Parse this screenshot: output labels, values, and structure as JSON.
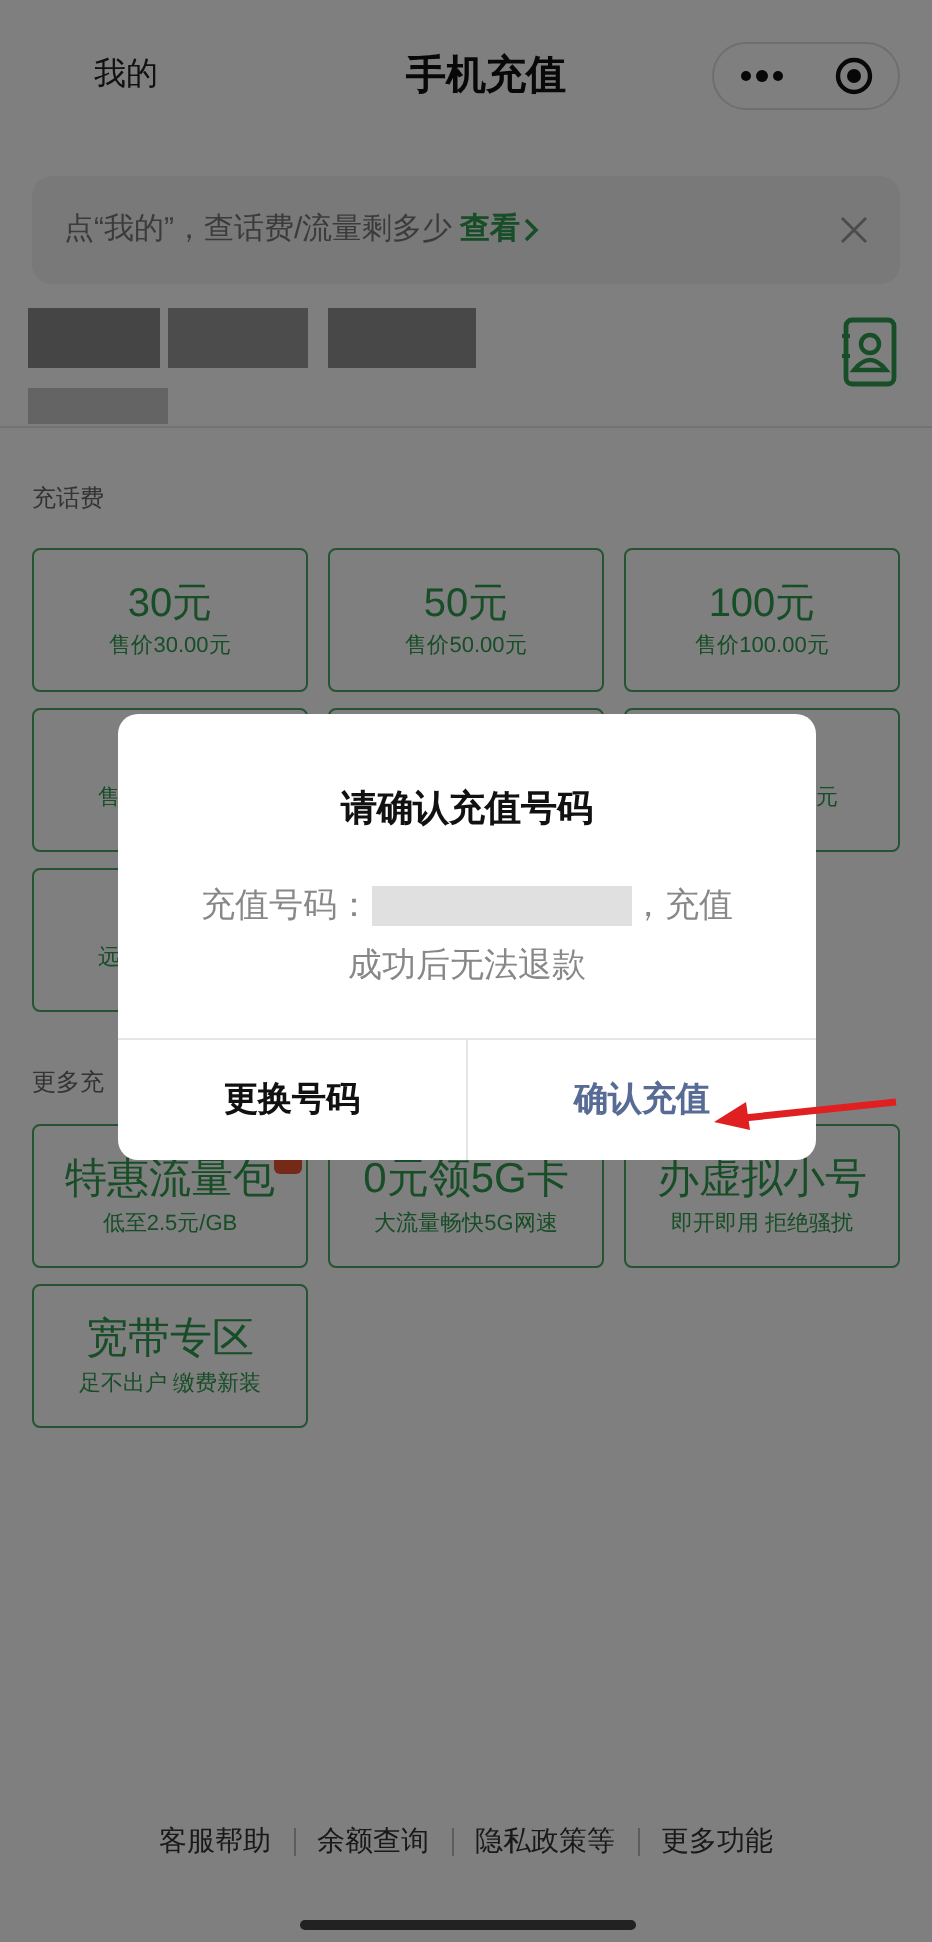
{
  "nav": {
    "back_label": "我的",
    "title": "手机充值"
  },
  "banner": {
    "text": "点“我的”，查话费/流量剩多少",
    "link": "查看"
  },
  "section_call": {
    "title": "充话费",
    "cards": [
      {
        "kind": "full",
        "amount": "30元",
        "price": "售价30.00元"
      },
      {
        "kind": "full",
        "amount": "50元",
        "price": "售价50.00元"
      },
      {
        "kind": "full",
        "amount": "100元",
        "price": "售价100.00元"
      },
      {
        "kind": "left",
        "price": "售"
      },
      {
        "kind": "hidden"
      },
      {
        "kind": "right",
        "price": "元"
      },
      {
        "kind": "left",
        "price": "远"
      }
    ]
  },
  "section_more": {
    "title": "更多充",
    "cards": [
      {
        "title": "特惠流量包",
        "subtitle": "低至2.5元/GB",
        "badge": true
      },
      {
        "title": "0元领5G卡",
        "subtitle": "大流量畅快5G网速",
        "badge": false
      },
      {
        "title": "办虚拟小号",
        "subtitle": "即开即用 拒绝骚扰",
        "badge": false
      },
      {
        "title": "宽带专区",
        "subtitle": "足不出户 缴费新装",
        "badge": false
      }
    ]
  },
  "footer_links": [
    "客服帮助",
    "余额查询",
    "隐私政策等",
    "更多功能"
  ],
  "dialog": {
    "title": "请确认充值号码",
    "body_prefix": "充值号码：",
    "body_suffix": "，充值",
    "body_line2": "成功后无法退款",
    "cancel": "更换号码",
    "confirm": "确认充值"
  }
}
